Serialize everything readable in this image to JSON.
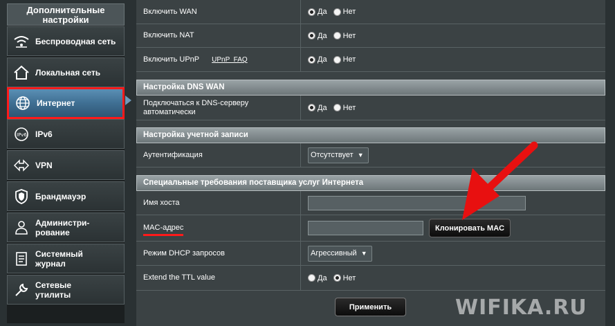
{
  "sidebar": {
    "header": "Дополнительные настройки",
    "items": [
      {
        "label": "Беспроводная сеть",
        "icon": "wifi-icon"
      },
      {
        "label": "Локальная сеть",
        "icon": "home-icon"
      },
      {
        "label": "Интернет",
        "icon": "globe-icon",
        "active": true
      },
      {
        "label": "IPv6",
        "icon": "ipv6-icon"
      },
      {
        "label": "VPN",
        "icon": "vpn-icon"
      },
      {
        "label": "Брандмауэр",
        "icon": "shield-icon"
      },
      {
        "label": "Администри-рование",
        "icon": "admin-icon"
      },
      {
        "label": "Системный журнал",
        "icon": "log-icon"
      },
      {
        "label": "Сетевые утилиты",
        "icon": "wrench-icon"
      }
    ]
  },
  "form": {
    "wan": {
      "label": "Включить WAN",
      "yes": "Да",
      "no": "Нет",
      "selected": "yes"
    },
    "nat": {
      "label": "Включить NAT",
      "yes": "Да",
      "no": "Нет",
      "selected": "yes"
    },
    "upnp": {
      "label": "Включить UPnP",
      "link": "UPnP  FAQ",
      "yes": "Да",
      "no": "Нет",
      "selected": "yes"
    },
    "dns_section": "Настройка DNS WAN",
    "dns_auto": {
      "label": "Подключаться к DNS-серверу автоматически",
      "yes": "Да",
      "no": "Нет",
      "selected": "yes"
    },
    "account_section": "Настройка учетной записи",
    "auth": {
      "label": "Аутентификация",
      "value": "Отсутствует"
    },
    "isp_section": "Специальные требования поставщика услуг Интернета",
    "hostname": {
      "label": "Имя хоста",
      "value": ""
    },
    "mac": {
      "label": "MAC-адрес",
      "value": "",
      "clone_button": "Клонировать MAC"
    },
    "dhcp": {
      "label": "Режим DHCP запросов",
      "value": "Агрессивный"
    },
    "ttl": {
      "label": "Extend the TTL value",
      "yes": "Да",
      "no": "Нет",
      "selected": "no"
    },
    "apply_button": "Применить"
  },
  "watermark": "WIFIKA.RU",
  "colors": {
    "highlight": "#ff1a1a",
    "active": "#4a7ea3",
    "panel": "#3b4244"
  }
}
